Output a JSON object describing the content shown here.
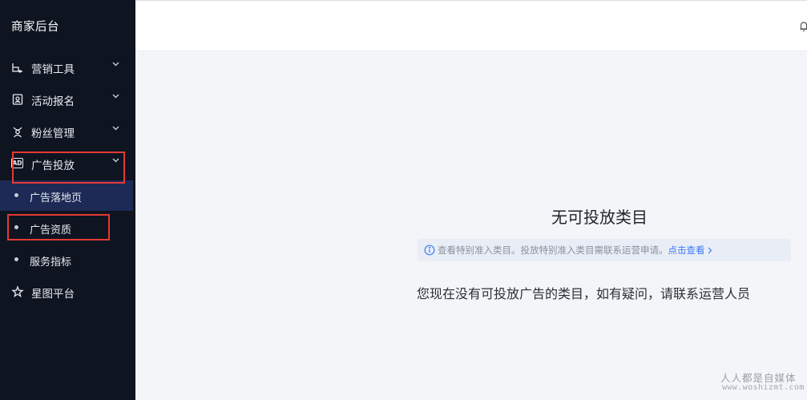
{
  "sidebar": {
    "brand": "商家后台",
    "menu": [
      {
        "label": "营销工具",
        "icon": "marketing-tools-icon"
      },
      {
        "label": "活动报名",
        "icon": "activity-signup-icon"
      },
      {
        "label": "粉丝管理",
        "icon": "fans-management-icon"
      },
      {
        "label": "广告投放",
        "icon": "ad-icon",
        "icon_text": "AD",
        "expanded": true
      },
      {
        "label": "星图平台",
        "icon": "star-map-icon"
      }
    ],
    "submenu": [
      {
        "label": "广告落地页",
        "active": true
      },
      {
        "label": "广告资质",
        "active": false
      },
      {
        "label": "服务指标",
        "active": false
      }
    ],
    "highlight_color": "#e53935",
    "active_bg": "#1d2a55"
  },
  "main": {
    "empty_title": "无可投放类目",
    "notice": {
      "text": "查看特别准入类目。投放特别准入类目需联系运营申请。",
      "link": "点击查看"
    },
    "hint": "您现在没有可投放广告的类目，如有疑问，请联系运营人员"
  },
  "watermark": {
    "cn": "人人都是自媒体",
    "en": "www.woshizmt.com"
  },
  "colors": {
    "sidebar_bg": "#0e1420",
    "content_bg": "#f4f5f9",
    "link": "#3b7cf5"
  }
}
